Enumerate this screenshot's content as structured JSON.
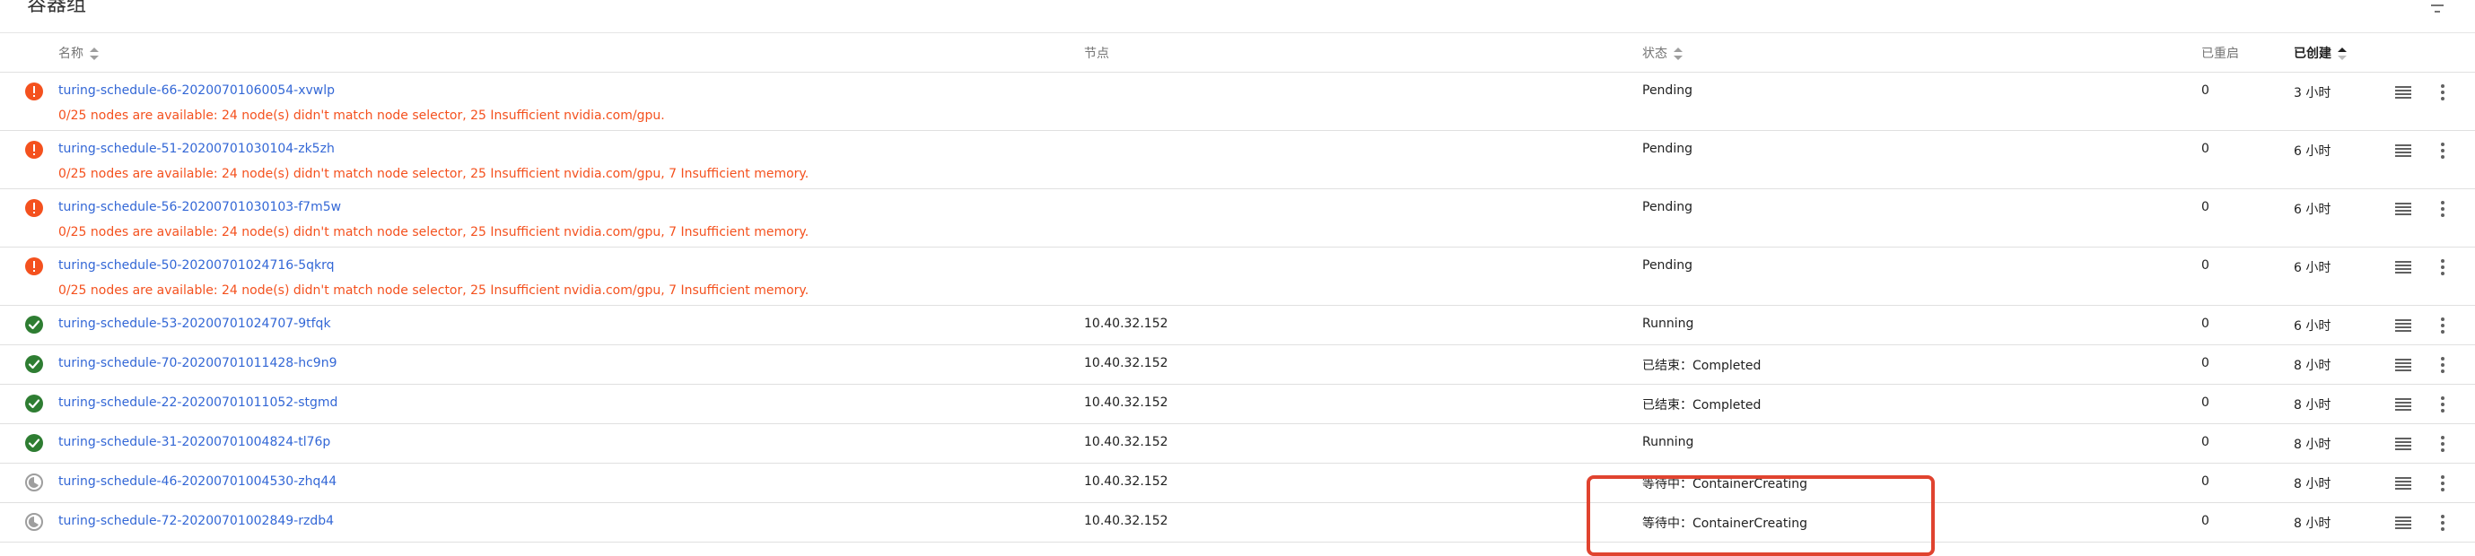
{
  "card": {
    "title": "容器组"
  },
  "table": {
    "headers": {
      "name": "名称",
      "node": "节点",
      "status": "状态",
      "restarts": "已重启",
      "created": "已创建"
    },
    "rows": [
      {
        "state": "error",
        "name": "turing-schedule-66-20200701060054-xvwlp",
        "message": "0/25 nodes are available: 24 node(s) didn't match node selector, 25 Insufficient nvidia.com/gpu.",
        "node": "",
        "status": "Pending",
        "restarts": "0",
        "age": "3 小时"
      },
      {
        "state": "error",
        "name": "turing-schedule-51-20200701030104-zk5zh",
        "message": "0/25 nodes are available: 24 node(s) didn't match node selector, 25 Insufficient nvidia.com/gpu, 7 Insufficient memory.",
        "node": "",
        "status": "Pending",
        "restarts": "0",
        "age": "6 小时"
      },
      {
        "state": "error",
        "name": "turing-schedule-56-20200701030103-f7m5w",
        "message": "0/25 nodes are available: 24 node(s) didn't match node selector, 25 Insufficient nvidia.com/gpu, 7 Insufficient memory.",
        "node": "",
        "status": "Pending",
        "restarts": "0",
        "age": "6 小时"
      },
      {
        "state": "error",
        "name": "turing-schedule-50-20200701024716-5qkrq",
        "message": "0/25 nodes are available: 24 node(s) didn't match node selector, 25 Insufficient nvidia.com/gpu, 7 Insufficient memory.",
        "node": "",
        "status": "Pending",
        "restarts": "0",
        "age": "6 小时"
      },
      {
        "state": "success",
        "name": "turing-schedule-53-20200701024707-9tfqk",
        "message": "",
        "node": "10.40.32.152",
        "status": "Running",
        "restarts": "0",
        "age": "6 小时"
      },
      {
        "state": "success",
        "name": "turing-schedule-70-20200701011428-hc9n9",
        "message": "",
        "node": "10.40.32.152",
        "status": "已结束：Completed",
        "restarts": "0",
        "age": "8 小时"
      },
      {
        "state": "success",
        "name": "turing-schedule-22-20200701011052-stgmd",
        "message": "",
        "node": "10.40.32.152",
        "status": "已结束：Completed",
        "restarts": "0",
        "age": "8 小时"
      },
      {
        "state": "success",
        "name": "turing-schedule-31-20200701004824-tl76p",
        "message": "",
        "node": "10.40.32.152",
        "status": "Running",
        "restarts": "0",
        "age": "8 小时"
      },
      {
        "state": "pending",
        "name": "turing-schedule-46-20200701004530-zhq44",
        "message": "",
        "node": "10.40.32.152",
        "status": "等待中：ContainerCreating",
        "restarts": "0",
        "age": "8 小时"
      },
      {
        "state": "pending",
        "name": "turing-schedule-72-20200701002849-rzdb4",
        "message": "",
        "node": "10.40.32.152",
        "status": "等待中：ContainerCreating",
        "restarts": "0",
        "age": "8 小时"
      }
    ]
  },
  "icons": {
    "error": "error-circle-icon",
    "success": "check-circle-icon",
    "pending": "pending-circle-icon",
    "logs": "logs-icon",
    "more": "more-vert-icon",
    "filter": "filter-icon",
    "sort": "sort-icon",
    "sort_desc": "sort-desc-icon"
  },
  "colors": {
    "link": "#3367d6",
    "error": "#f4511e",
    "success": "#2e7d32",
    "pending": "#9e9e9e",
    "highlight": "#e0432f"
  }
}
